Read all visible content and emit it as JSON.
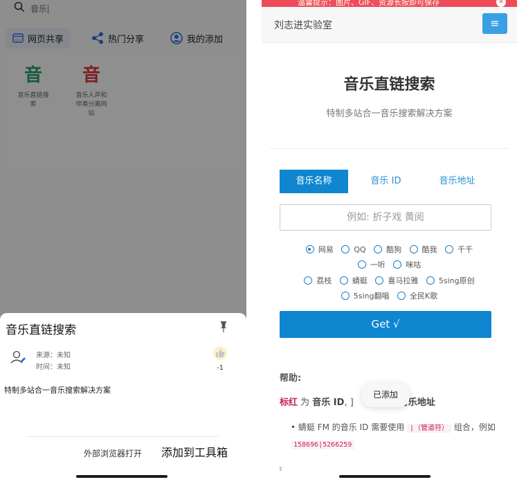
{
  "left": {
    "search": {
      "text": "音乐"
    },
    "tabs": [
      {
        "label": "网页共享",
        "icon": "webpage-icon",
        "active": true
      },
      {
        "label": "热门分享",
        "icon": "share-icon",
        "active": false
      },
      {
        "label": "我的添加",
        "icon": "profile-icon",
        "active": false
      }
    ],
    "apps": [
      {
        "glyph": "音",
        "name_line1": "音乐直链搜",
        "name_line2": "索",
        "name_line3": "",
        "color": "#2e9a68"
      },
      {
        "glyph": "音",
        "name_line1": "音乐人声和",
        "name_line2": "伴奏分离网",
        "name_line3": "站",
        "color": "#d2373c"
      }
    ],
    "sheet": {
      "title": "音乐直链搜索",
      "source": "来源：未知",
      "time": "时间：未知",
      "likes": "-1",
      "description": "特制多站合一音乐搜索解决方案",
      "open_external": "外部浏览器打开",
      "add_toolbox": "添加到工具箱"
    }
  },
  "right": {
    "banner": {
      "text": "温馨提示：图片、GIF、资源长按即可保存"
    },
    "nav": {
      "site_title": "刘志进实验室",
      "menu_icon": "≡"
    },
    "hero": {
      "title": "音乐直链搜索",
      "subtitle": "特制多站合一音乐搜索解决方案"
    },
    "mode_tabs": [
      "音乐名称",
      "音乐 ID",
      "音乐地址"
    ],
    "input": {
      "placeholder": "例如: 折子戏 黄阅"
    },
    "sources": {
      "row1": [
        "网易",
        "QQ",
        "酷狗",
        "酷我",
        "千千"
      ],
      "row2": [
        "一听",
        "咪咕"
      ],
      "row3": [
        "荔枝",
        "蜻蜓",
        "喜马拉雅",
        "5sing原创"
      ],
      "row4": [
        "5sing翻唱",
        "全民K歌"
      ],
      "selected": "网易"
    },
    "get_button": "Get √",
    "help": {
      "label": "帮助:",
      "red_word": "标红",
      "mid1": " 为 ",
      "kw1": "音乐 ID",
      "mid2": ", ]",
      "kw2": "音乐地址",
      "bullet_pre": "蜻蜓 FM 的音乐 ID 需要使用",
      "bullet_code": "|（管道符）",
      "bullet_mid": "组合，例如",
      "bullet_example": "158696|5266259"
    },
    "toast": "已添加"
  }
}
